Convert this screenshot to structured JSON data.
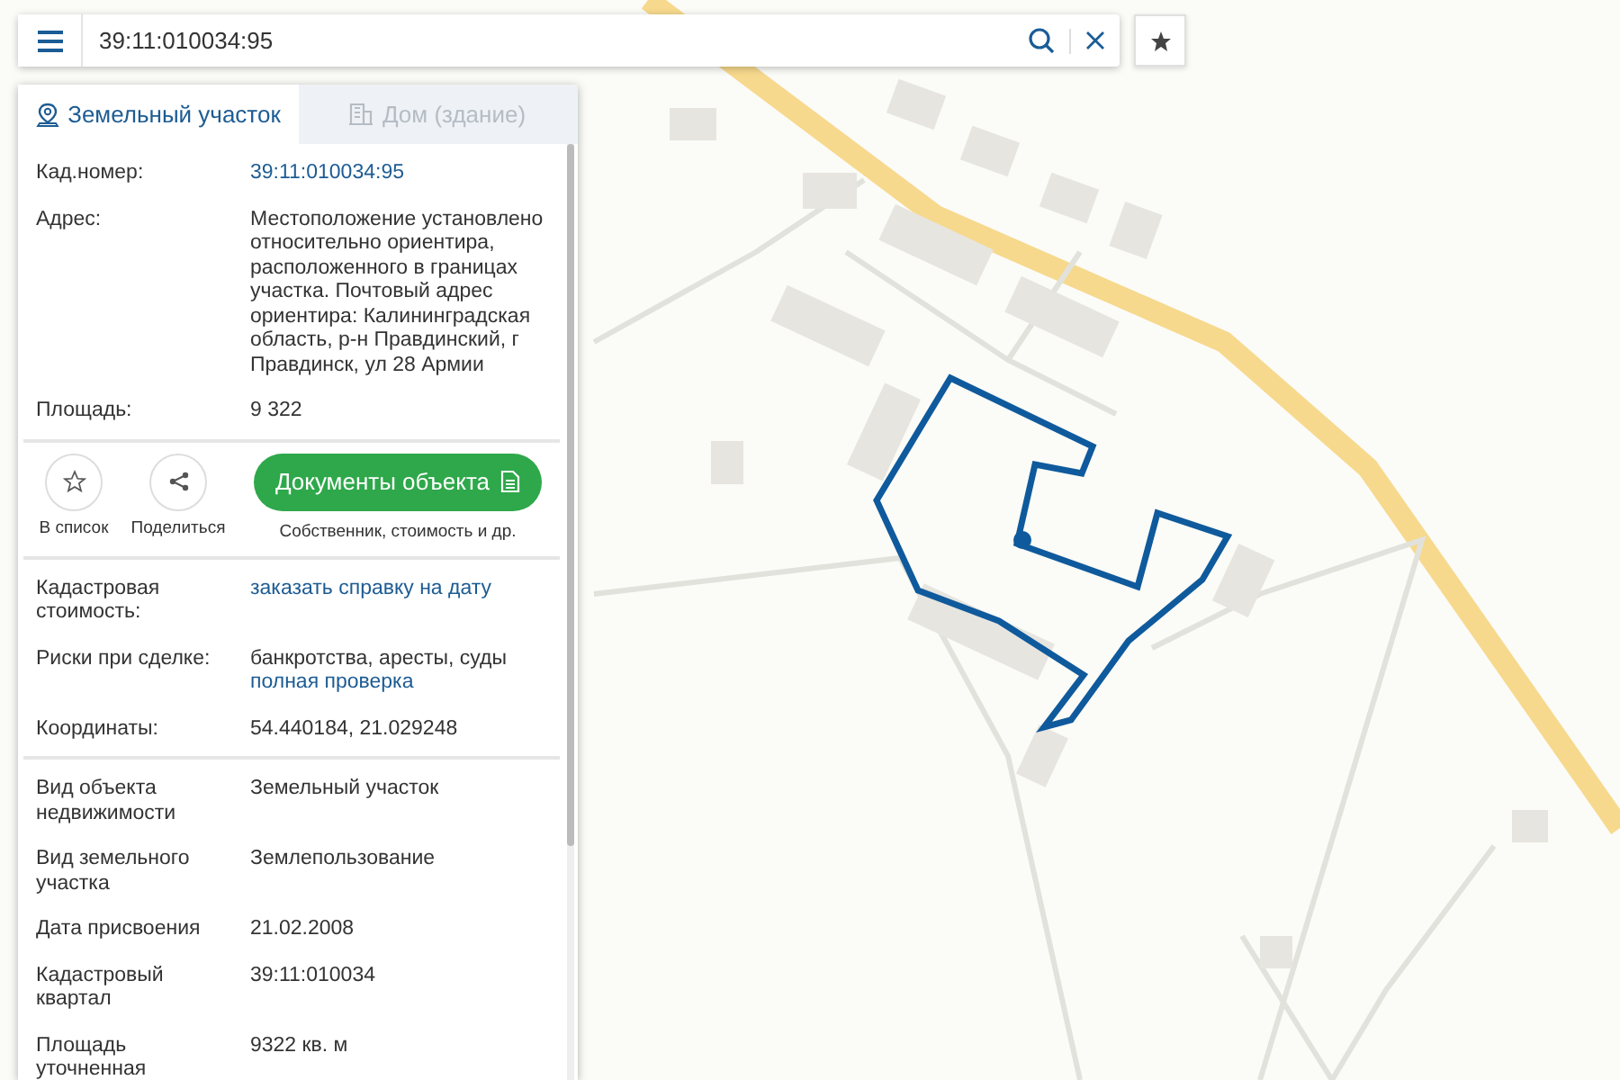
{
  "search": {
    "value": "39:11:010034:95"
  },
  "tabs": [
    {
      "label": "Земельный участок",
      "selected": true,
      "kind": "pin"
    },
    {
      "label": "Дом (здание)",
      "selected": false,
      "kind": "building"
    }
  ],
  "sections": [
    {
      "rows": [
        {
          "label": "Кад.номер:",
          "value": [
            {
              "text": "39:11:010034:95",
              "kind": "link"
            }
          ]
        },
        {
          "label": "Адрес:",
          "value": [
            {
              "text": "Местоположение установлено относительно ориентира, расположенного в границах участка. Почтовый адрес ориентира: Калининградская область, р-н Правдинский, г Правдинск, ул 28 Армии",
              "kind": "text"
            }
          ]
        },
        {
          "label": "Площадь:",
          "value": [
            {
              "text": "9 322",
              "kind": "text"
            }
          ]
        }
      ]
    },
    {
      "rows": [
        {
          "label": "Кадастровая стоимость:",
          "value": [
            {
              "text": "заказать справку на дату",
              "kind": "link"
            }
          ]
        },
        {
          "label": "Риски при сделке:",
          "value": [
            {
              "text": "банкротства, аресты, суды",
              "kind": "text"
            },
            {
              "text": "полная проверка",
              "kind": "link"
            }
          ]
        },
        {
          "label": "Координаты:",
          "value": [
            {
              "text": "54.440184, 21.029248",
              "kind": "text"
            }
          ]
        }
      ]
    },
    {
      "rows": [
        {
          "label": "Вид объекта недвижимости",
          "value": [
            {
              "text": "Земельный участок",
              "kind": "text"
            }
          ]
        },
        {
          "label": "Вид земельного участка",
          "value": [
            {
              "text": "Землепользование",
              "kind": "text"
            }
          ]
        },
        {
          "label": "Дата присвоения",
          "value": [
            {
              "text": "21.02.2008",
              "kind": "text"
            }
          ]
        },
        {
          "label": "Кадастровый квартал",
          "value": [
            {
              "text": "39:11:010034",
              "kind": "text"
            }
          ]
        },
        {
          "label": "Площадь уточненная",
          "value": [
            {
              "text": "9322 кв. м",
              "kind": "text"
            }
          ]
        }
      ]
    }
  ],
  "actions": {
    "round_buttons": [
      {
        "label": "В список",
        "kind": "star"
      },
      {
        "label": "Поделиться",
        "kind": "share"
      }
    ],
    "documents_button": {
      "label": "Документы объекта",
      "caption": "Собственник, стоимость и др."
    }
  }
}
